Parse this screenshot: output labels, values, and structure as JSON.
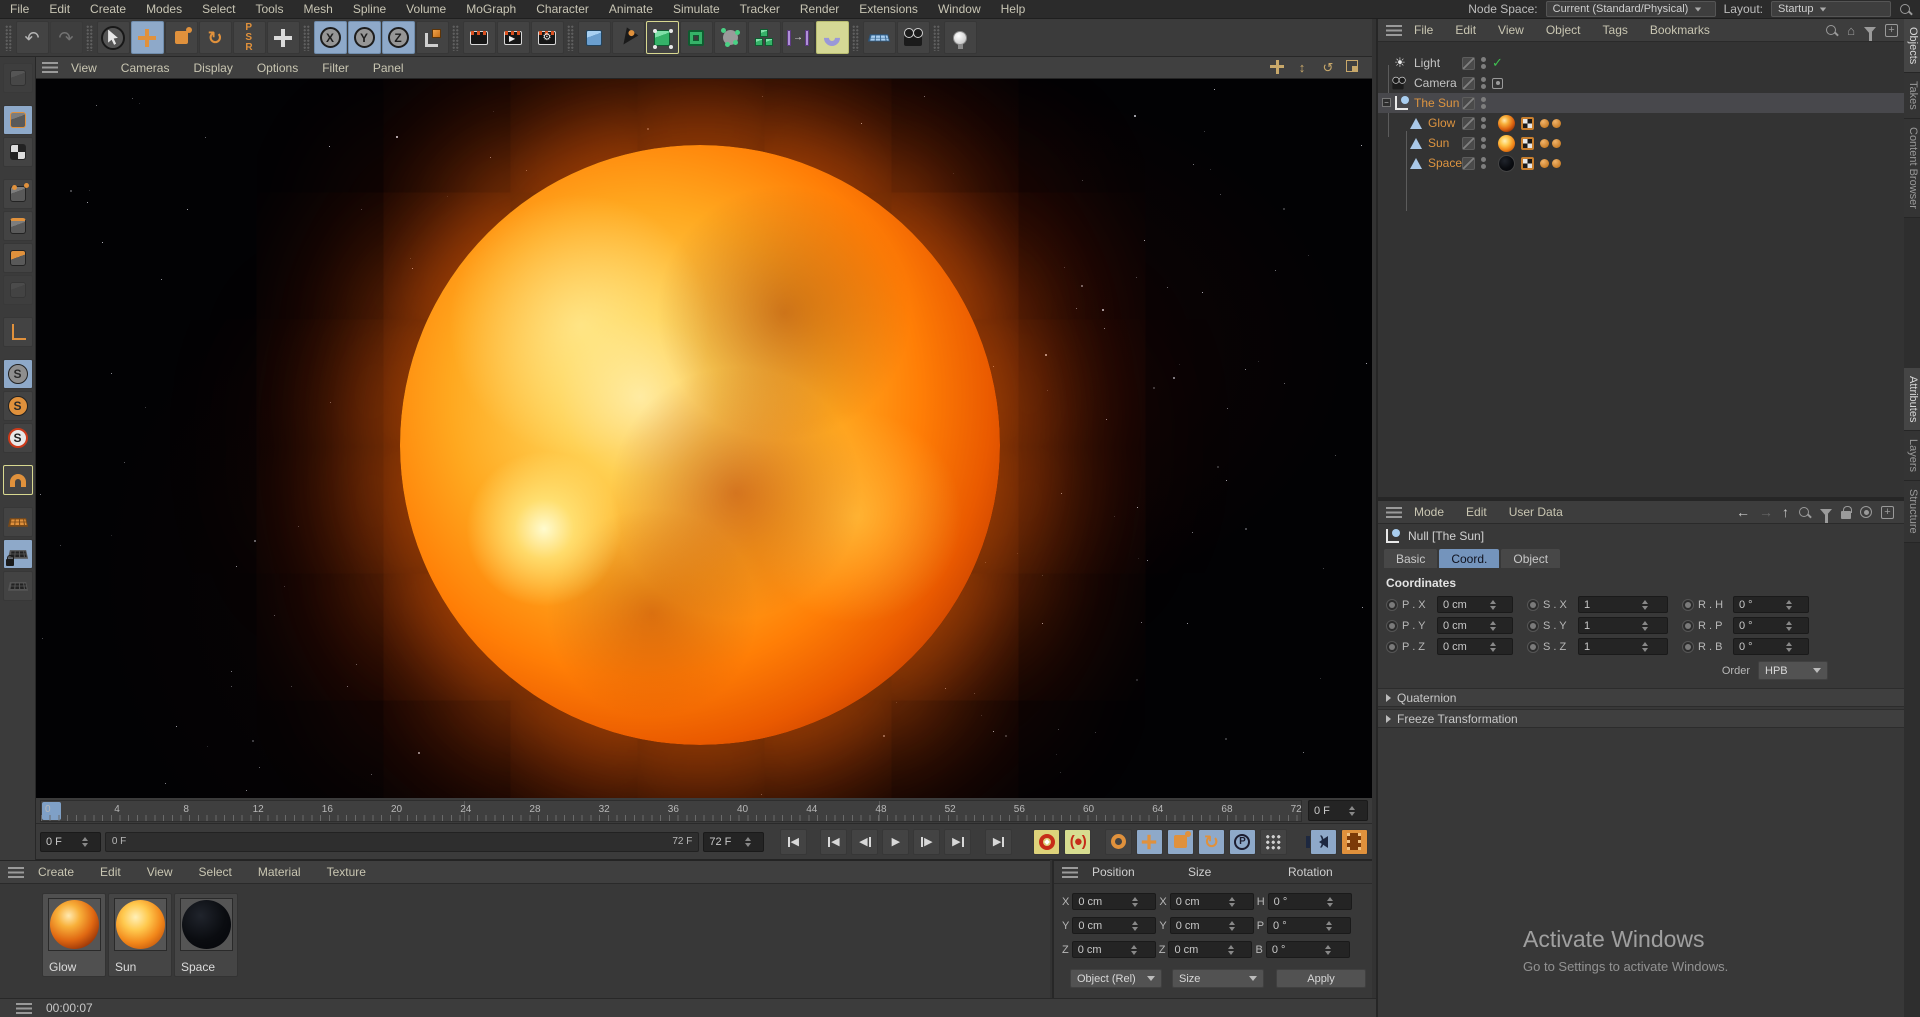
{
  "colors": {
    "chrome": "#3b3b3b",
    "chrome_dark": "#2b2b2b",
    "accent_orange": "#e0913c",
    "accent_blue": "#8ea9c9",
    "accent_yellow": "#d5d895",
    "selected_text": "#dd9440",
    "tab_active_blue": "#7494bc",
    "playhead_blue": "#7fa0c6"
  },
  "menubar": {
    "items": [
      "File",
      "Edit",
      "Create",
      "Modes",
      "Select",
      "Tools",
      "Mesh",
      "Spline",
      "Volume",
      "MoGraph",
      "Character",
      "Animate",
      "Simulate",
      "Tracker",
      "Render",
      "Extensions",
      "Window",
      "Help"
    ],
    "node_space_label": "Node Space:",
    "node_space_value": "Current (Standard/Physical)",
    "layout_label": "Layout:",
    "layout_value": "Startup"
  },
  "toolbar": {
    "icons": [
      "undo",
      "redo",
      "live-selection",
      "move",
      "scale",
      "rotate",
      "psr-recent",
      "last-tool",
      "x-axis-lock",
      "y-axis-lock",
      "z-axis-lock",
      "coordinate-system",
      "render-view",
      "render-to-picture-viewer",
      "render-settings",
      "add-cube",
      "spline-pen",
      "subdivision-surface",
      "extrude",
      "volume-builder",
      "cloner",
      "field",
      "bend-deformer",
      "floor",
      "camera",
      "light"
    ]
  },
  "left_palette": {
    "icons": [
      "make-editable",
      "model-mode",
      "texture-mode",
      "point-mode",
      "edge-mode",
      "polygon-mode",
      "tweak-mode",
      "enable-axis",
      "solo-off",
      "solo-single",
      "solo-hierarchy",
      "snap",
      "workplane",
      "lock-workplane",
      "planar-workplane"
    ]
  },
  "viewport": {
    "menu": [
      "View",
      "Cameras",
      "Display",
      "Options",
      "Filter",
      "Panel"
    ],
    "nav_icons": [
      "pan",
      "dolly",
      "orbit",
      "toggle-panel"
    ]
  },
  "timeline": {
    "ticks": [
      "0",
      "4",
      "8",
      "12",
      "16",
      "20",
      "24",
      "28",
      "32",
      "36",
      "40",
      "44",
      "48",
      "52",
      "56",
      "60",
      "64",
      "68",
      "72"
    ],
    "current_frame": "0 F",
    "range_start": "0 F",
    "range_end": "72 F",
    "end_frame": "72 F",
    "transport_buttons": [
      "goto-start",
      "previous-key",
      "previous-frame",
      "play-forward",
      "next-frame",
      "next-key",
      "goto-end"
    ],
    "record_buttons": [
      "record-keyframe",
      "autokeying",
      "keyframe-selection",
      "record-position",
      "record-scale",
      "record-rotation",
      "record-parameter",
      "point-level-animation",
      "play-sound",
      "render-preview"
    ]
  },
  "materials": {
    "menu": [
      "Create",
      "Edit",
      "View",
      "Select",
      "Material",
      "Texture"
    ],
    "items": [
      {
        "name": "Glow",
        "color": "#e06812"
      },
      {
        "name": "Sun",
        "color": "#f2871a"
      },
      {
        "name": "Space",
        "color": "#0a0c10"
      }
    ]
  },
  "coords_panel": {
    "headers": [
      "Position",
      "Size",
      "Rotation"
    ],
    "rows": [
      {
        "pos_axis": "X",
        "pos_value": "0 cm",
        "size_axis": "X",
        "size_value": "0 cm",
        "rot_axis": "H",
        "rot_value": "0 °"
      },
      {
        "pos_axis": "Y",
        "pos_value": "0 cm",
        "size_axis": "Y",
        "size_value": "0 cm",
        "rot_axis": "P",
        "rot_value": "0 °"
      },
      {
        "pos_axis": "Z",
        "pos_value": "0 cm",
        "size_axis": "Z",
        "size_value": "0 cm",
        "rot_axis": "B",
        "rot_value": "0 °"
      }
    ],
    "object_mode": "Object (Rel)",
    "size_mode": "Size",
    "apply_label": "Apply"
  },
  "object_manager": {
    "menu": [
      "File",
      "Edit",
      "View",
      "Object",
      "Tags",
      "Bookmarks"
    ],
    "objects": [
      {
        "name": "Light",
        "type": "light"
      },
      {
        "name": "Camera",
        "type": "camera"
      },
      {
        "name": "The Sun",
        "type": "null",
        "selected": true,
        "expanded": true
      },
      {
        "name": "Glow",
        "type": "sky",
        "child": true
      },
      {
        "name": "Sun",
        "type": "sky",
        "child": true
      },
      {
        "name": "Space",
        "type": "sky",
        "child": true
      }
    ]
  },
  "attributes": {
    "menu": [
      "Mode",
      "Edit",
      "User Data"
    ],
    "title": "Null [The Sun]",
    "tabs": [
      "Basic",
      "Coord.",
      "Object"
    ],
    "active_tab": "Coord.",
    "section": "Coordinates",
    "coord_rows": [
      {
        "p_label": "P . X",
        "p_value": "0 cm",
        "s_label": "S . X",
        "s_value": "1",
        "r_label": "R . H",
        "r_value": "0 °"
      },
      {
        "p_label": "P . Y",
        "p_value": "0 cm",
        "s_label": "S . Y",
        "s_value": "1",
        "r_label": "R . P",
        "r_value": "0 °"
      },
      {
        "p_label": "P . Z",
        "p_value": "0 cm",
        "s_label": "S . Z",
        "s_value": "1",
        "r_label": "R . B",
        "r_value": "0 °"
      }
    ],
    "order_label": "Order",
    "order_value": "HPB",
    "groups": [
      "Quaternion",
      "Freeze Transformation"
    ]
  },
  "right_tabs": {
    "top": [
      "Objects",
      "Takes",
      "Content Browser"
    ],
    "bottom": [
      "Attributes",
      "Layers",
      "Structure"
    ]
  },
  "watermark": {
    "title": "Activate Windows",
    "subtitle": "Go to Settings to activate Windows."
  },
  "statusbar": {
    "time": "00:00:07"
  }
}
